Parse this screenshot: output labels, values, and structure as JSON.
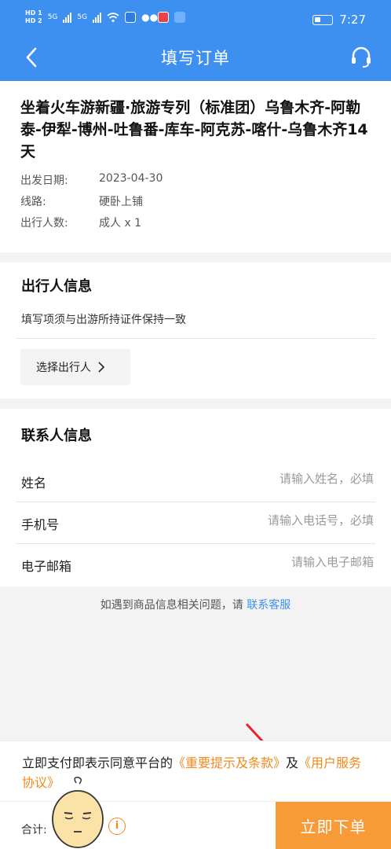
{
  "status_bar": {
    "time": "7:27",
    "sim1": "HD 1",
    "sim2": "HD 2",
    "network1": "5G",
    "network2": "5G",
    "icons": [
      "wifi-icon",
      "compass-app-icon",
      "wechat-icon",
      "red-app-icon",
      "cloud-app-icon",
      "battery-icon"
    ]
  },
  "header": {
    "title": "填写订单",
    "back_icon": "chevron-left-icon",
    "service_icon": "headset-icon",
    "background": "#3d8ff0"
  },
  "product": {
    "title": "坐着火车游新疆·旅游专列（标准团）乌鲁木齐-阿勒泰-伊犁-博州-吐鲁番-库车-阿克苏-喀什-乌鲁木齐14天",
    "details": [
      {
        "key": "出发日期:",
        "value": "2023-04-30"
      },
      {
        "key": "线路:",
        "value": "硬卧上铺"
      },
      {
        "key": "出行人数:",
        "value": "成人 x 1"
      }
    ]
  },
  "travelers": {
    "title": "出行人信息",
    "note": "填写项须与出游所持证件保持一致",
    "select_button": "选择出行人"
  },
  "contact": {
    "title": "联系人信息",
    "fields": [
      {
        "label": "姓名",
        "placeholder": "请输入姓名，必填",
        "value": ""
      },
      {
        "label": "手机号",
        "placeholder": "请输入电话号，必填",
        "value": ""
      },
      {
        "label": "电子邮箱",
        "placeholder": "请输入电子邮箱",
        "value": ""
      }
    ]
  },
  "help": {
    "text": "如遇到商品信息相关问题，请 ",
    "link": "联系客服"
  },
  "agreement": {
    "prefix": "立即支付即表示同意平台的",
    "link1": "《重要提示及条款》",
    "middle": "及",
    "link2": "《用户服务协议》"
  },
  "footer": {
    "total_label": "合计:",
    "info_icon": "info-circle-icon",
    "submit_button": "立即下单",
    "accent_color": "#f79b38"
  },
  "overlays": {
    "mascot_icon": "sleepy-face-sticker-icon",
    "arrow_icon": "red-pointer-arrow-icon"
  }
}
